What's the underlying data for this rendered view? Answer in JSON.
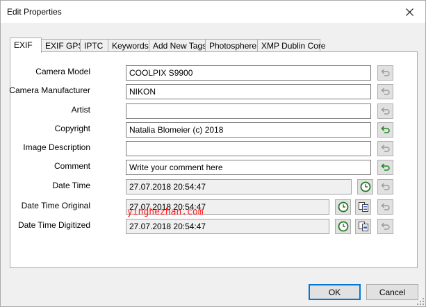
{
  "window": {
    "title": "Edit Properties"
  },
  "tabs": [
    {
      "label": "EXIF",
      "active": true
    },
    {
      "label": "EXIF GPS"
    },
    {
      "label": "IPTC"
    },
    {
      "label": "Keywords"
    },
    {
      "label": "Add New Tags"
    },
    {
      "label": "Photosphere"
    },
    {
      "label": "XMP Dublin Core"
    }
  ],
  "fields": [
    {
      "label": "Camera Model",
      "value": "COOLPIX S9900",
      "placeholder": "",
      "revert_enabled": false
    },
    {
      "label": "Camera Manufacturer",
      "value": "NIKON",
      "placeholder": "",
      "revert_enabled": false
    },
    {
      "label": "Artist",
      "value": "",
      "placeholder": "",
      "revert_enabled": false
    },
    {
      "label": "Copyright",
      "value": "Natalia Blomeier (c) 2018",
      "placeholder": "",
      "revert_enabled": true
    },
    {
      "label": "Image Description",
      "value": "",
      "placeholder": "",
      "revert_enabled": false
    },
    {
      "label": "Comment",
      "value": "",
      "placeholder": "Write your comment here",
      "revert_enabled": true
    },
    {
      "label": "Date Time",
      "value": "27.07.2018 20:54:47",
      "revert_enabled": false
    },
    {
      "label": "Date Time Original",
      "value": "27.07.2018 20:54:47",
      "revert_enabled": false
    },
    {
      "label": "Date Time Digitized",
      "value": "27.07.2018 20:54:47",
      "revert_enabled": false
    }
  ],
  "watermark": "yinghezhan.com",
  "buttons": {
    "ok": "OK",
    "cancel": "Cancel"
  },
  "icons": {
    "close": "close-icon",
    "revert": "undo-arrow-icon",
    "clock": "clock-icon",
    "copy": "copy-icon"
  },
  "colors": {
    "revert_active": "#1f8a1f",
    "revert_inactive": "#9a9a9a",
    "clock_ring": "#1e7e1e",
    "accent": "#0078d7"
  }
}
